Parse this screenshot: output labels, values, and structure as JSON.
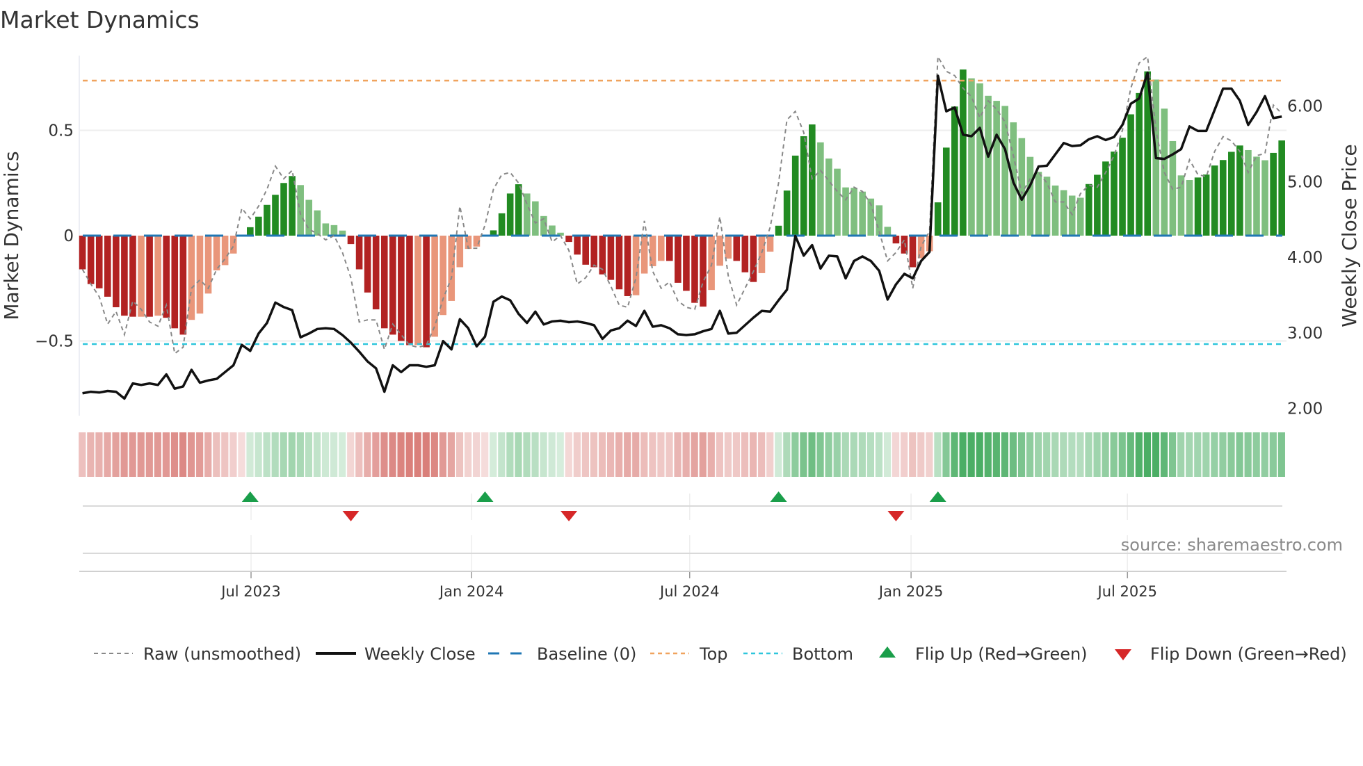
{
  "chart_data": {
    "type": "bar",
    "title": "Market Dynamics",
    "ylabel": "Market Dynamics",
    "y2label": "Weekly Close Price",
    "ylim": [
      -0.855,
      0.9
    ],
    "y2lim": [
      1.85,
      6.9
    ],
    "yticks": [
      {
        "value": 0.5,
        "label": "0.5"
      },
      {
        "value": 0,
        "label": "0"
      },
      {
        "value": -0.5,
        "label": "−0.5"
      }
    ],
    "y2ticks": [
      {
        "value": 6,
        "label": "6.00"
      },
      {
        "value": 5,
        "label": "5.00"
      },
      {
        "value": 4,
        "label": "4.00"
      },
      {
        "value": 3,
        "label": "3.00"
      },
      {
        "value": 2,
        "label": "2.00"
      }
    ],
    "xticks": [
      {
        "week_index": 20.1,
        "label": "Jul 2023"
      },
      {
        "week_index": 46.4,
        "label": "Jan 2024"
      },
      {
        "week_index": 72.4,
        "label": "Jul 2024"
      },
      {
        "week_index": 98.8,
        "label": "Jan 2025"
      },
      {
        "week_index": 124.6,
        "label": "Jul 2025"
      }
    ],
    "top_level": 0.736,
    "bottom_level": -0.515,
    "baseline": 0,
    "values": [
      -0.16,
      -0.23,
      -0.25,
      -0.29,
      -0.34,
      -0.38,
      -0.385,
      -0.385,
      -0.385,
      -0.38,
      -0.39,
      -0.44,
      -0.47,
      -0.4,
      -0.37,
      -0.275,
      -0.165,
      -0.14,
      -0.085,
      -0.005,
      0.04,
      0.09,
      0.146,
      0.194,
      0.25,
      0.283,
      0.24,
      0.17,
      0.12,
      0.058,
      0.05,
      0.024,
      -0.04,
      -0.16,
      -0.27,
      -0.35,
      -0.44,
      -0.47,
      -0.5,
      -0.52,
      -0.52,
      -0.53,
      -0.48,
      -0.377,
      -0.31,
      -0.15,
      -0.063,
      -0.052,
      -0.005,
      0.025,
      0.106,
      0.2,
      0.244,
      0.2,
      0.163,
      0.093,
      0.048,
      0.014,
      -0.03,
      -0.09,
      -0.138,
      -0.15,
      -0.184,
      -0.21,
      -0.255,
      -0.287,
      -0.283,
      -0.18,
      -0.145,
      -0.12,
      -0.12,
      -0.224,
      -0.262,
      -0.319,
      -0.337,
      -0.258,
      -0.143,
      -0.109,
      -0.12,
      -0.174,
      -0.22,
      -0.178,
      -0.076,
      0.047,
      0.214,
      0.38,
      0.472,
      0.528,
      0.443,
      0.366,
      0.318,
      0.229,
      0.227,
      0.209,
      0.176,
      0.144,
      0.042,
      -0.037,
      -0.085,
      -0.15,
      -0.107,
      -0.074,
      0.158,
      0.418,
      0.613,
      0.789,
      0.747,
      0.723,
      0.664,
      0.64,
      0.616,
      0.538,
      0.463,
      0.374,
      0.303,
      0.28,
      0.238,
      0.216,
      0.19,
      0.18,
      0.245,
      0.289,
      0.352,
      0.399,
      0.465,
      0.576,
      0.677,
      0.78,
      0.741,
      0.603,
      0.449,
      0.286,
      0.264,
      0.276,
      0.29,
      0.333,
      0.359,
      0.398,
      0.428,
      0.406,
      0.375,
      0.358,
      0.393,
      0.452
    ],
    "strong": [
      1,
      1,
      1,
      1,
      1,
      1,
      1,
      0,
      1,
      0,
      1,
      1,
      1,
      0,
      0,
      0,
      0,
      0,
      0,
      0,
      1,
      1,
      1,
      1,
      1,
      1,
      0,
      0,
      0,
      0,
      0,
      0,
      1,
      1,
      1,
      1,
      1,
      1,
      1,
      1,
      0,
      1,
      0,
      0,
      0,
      0,
      0,
      0,
      0,
      1,
      1,
      1,
      1,
      0,
      0,
      0,
      0,
      0,
      1,
      1,
      1,
      1,
      1,
      1,
      1,
      1,
      0,
      0,
      0,
      0,
      1,
      1,
      1,
      1,
      1,
      0,
      0,
      0,
      1,
      1,
      1,
      0,
      0,
      1,
      1,
      1,
      1,
      1,
      0,
      0,
      0,
      0,
      0,
      0,
      0,
      0,
      0,
      1,
      1,
      1,
      0,
      0,
      1,
      1,
      1,
      1,
      0,
      0,
      0,
      0,
      0,
      0,
      0,
      0,
      0,
      0,
      0,
      0,
      0,
      0,
      1,
      1,
      1,
      1,
      1,
      1,
      1,
      1,
      0,
      0,
      0,
      0,
      0,
      1,
      1,
      1,
      1,
      1,
      1,
      0,
      0,
      0,
      1,
      1
    ],
    "raw": [
      -0.16,
      -0.23,
      -0.29,
      -0.42,
      -0.36,
      -0.47,
      -0.31,
      -0.35,
      -0.41,
      -0.43,
      -0.33,
      -0.56,
      -0.53,
      -0.25,
      -0.21,
      -0.25,
      -0.16,
      -0.11,
      -0.05,
      0.13,
      0.08,
      0.14,
      0.22,
      0.33,
      0.27,
      0.31,
      0.1,
      0.03,
      0.01,
      -0.02,
      0.0,
      -0.08,
      -0.2,
      -0.41,
      -0.4,
      -0.4,
      -0.54,
      -0.42,
      -0.47,
      -0.52,
      -0.53,
      -0.52,
      -0.43,
      -0.3,
      -0.2,
      0.14,
      -0.06,
      -0.06,
      0.05,
      0.22,
      0.29,
      0.3,
      0.25,
      0.15,
      0.06,
      0.08,
      -0.03,
      0.0,
      -0.07,
      -0.23,
      -0.2,
      -0.14,
      -0.16,
      -0.24,
      -0.33,
      -0.34,
      -0.2,
      0.07,
      -0.17,
      -0.25,
      -0.22,
      -0.31,
      -0.34,
      -0.35,
      -0.22,
      -0.14,
      0.09,
      -0.19,
      -0.33,
      -0.25,
      -0.17,
      -0.08,
      0.04,
      0.25,
      0.55,
      0.59,
      0.49,
      0.27,
      0.31,
      0.26,
      0.21,
      0.17,
      0.23,
      0.21,
      0.15,
      0.02,
      -0.12,
      -0.08,
      -0.02,
      -0.25,
      -0.05,
      0.02,
      0.85,
      0.78,
      0.76,
      0.7,
      0.66,
      0.56,
      0.64,
      0.6,
      0.54,
      0.38,
      0.2,
      0.27,
      0.3,
      0.25,
      0.16,
      0.16,
      0.1,
      0.2,
      0.24,
      0.23,
      0.3,
      0.38,
      0.5,
      0.7,
      0.82,
      0.85,
      0.5,
      0.3,
      0.22,
      0.23,
      0.36,
      0.29,
      0.28,
      0.4,
      0.47,
      0.45,
      0.4,
      0.3,
      0.38,
      0.39,
      0.62,
      0.58
    ],
    "weekly_close": [
      2.2,
      2.22,
      2.21,
      2.23,
      2.22,
      2.13,
      2.33,
      2.31,
      2.33,
      2.31,
      2.45,
      2.26,
      2.29,
      2.51,
      2.34,
      2.37,
      2.39,
      2.48,
      2.57,
      2.84,
      2.76,
      2.99,
      3.13,
      3.4,
      3.34,
      3.3,
      2.94,
      2.99,
      3.05,
      3.06,
      3.05,
      2.97,
      2.87,
      2.75,
      2.62,
      2.53,
      2.22,
      2.57,
      2.48,
      2.57,
      2.57,
      2.55,
      2.57,
      2.89,
      2.78,
      3.18,
      3.06,
      2.82,
      2.95,
      3.41,
      3.48,
      3.43,
      3.25,
      3.13,
      3.28,
      3.11,
      3.15,
      3.16,
      3.14,
      3.15,
      3.13,
      3.1,
      2.92,
      3.03,
      3.06,
      3.16,
      3.09,
      3.29,
      3.08,
      3.1,
      3.06,
      2.98,
      2.97,
      2.98,
      3.02,
      3.05,
      3.29,
      2.99,
      3.0,
      3.1,
      3.2,
      3.29,
      3.28,
      3.43,
      3.57,
      4.28,
      4.02,
      4.16,
      3.85,
      4.02,
      4.01,
      3.72,
      3.95,
      4.01,
      3.95,
      3.82,
      3.44,
      3.64,
      3.78,
      3.72,
      3.95,
      4.07,
      6.4,
      5.93,
      5.98,
      5.62,
      5.6,
      5.71,
      5.33,
      5.62,
      5.43,
      4.99,
      4.76,
      4.95,
      5.2,
      5.21,
      5.36,
      5.51,
      5.47,
      5.48,
      5.56,
      5.6,
      5.55,
      5.59,
      5.75,
      6.03,
      6.1,
      6.44,
      5.31,
      5.3,
      5.36,
      5.43,
      5.73,
      5.67,
      5.67,
      5.95,
      6.23,
      6.23,
      6.07,
      5.75,
      5.92,
      6.13,
      5.84,
      5.86
    ],
    "flip_up_weeks": [
      20,
      48,
      83,
      102
    ],
    "flip_down_weeks": [
      32,
      58,
      97
    ],
    "legend": {
      "placement": "bottom",
      "raw": "Raw (unsmoothed)",
      "close": "Weekly Close",
      "baseline": "Baseline (0)",
      "top": "Top",
      "bottom": "Bottom",
      "flip_up": "Flip Up (Red→Green)",
      "flip_down": "Flip Down (Green→Red)"
    },
    "colors": {
      "neg_strong": "#b22222",
      "neg_weak": "#e9967a",
      "pos_strong": "#228b22",
      "pos_weak": "#7fbf7f",
      "baseline": "#1f77b4",
      "top": "#f0a35e",
      "bottom": "#2ec6dc",
      "close": "#111111",
      "raw": "#888888",
      "flip_up": "#1a9e4a",
      "flip_down": "#d62728"
    }
  },
  "source": "source: sharemaestro.com"
}
